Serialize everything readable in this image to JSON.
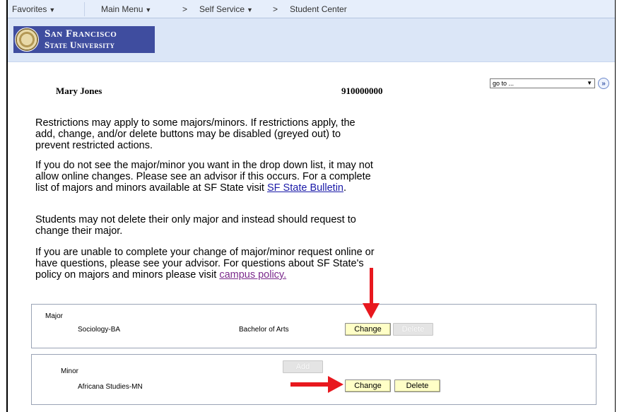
{
  "nav": {
    "favorites": "Favorites",
    "main_menu": "Main Menu",
    "separator": ">",
    "self_service": "Self Service",
    "student_center": "Student Center"
  },
  "logo": {
    "line1": "San Francisco",
    "line2": "State University"
  },
  "student": {
    "name": "Mary Jones",
    "id": "910000000"
  },
  "goto": {
    "selected": "go to ...",
    "button": "»"
  },
  "paragraphs": {
    "p1": "Restrictions may apply to some majors/minors. If restrictions apply, the add, change, and/or delete buttons may be disabled (greyed out) to prevent restricted actions.",
    "p2_text": "If you do not see the major/minor you want in the drop down list, it may not allow online changes. Please see an advisor if this occurs. For a complete list of majors and minors available at SF State visit ",
    "p2_link": "SF State Bulletin",
    "p2_end": ".",
    "p3": "Students may not delete their only major and instead should request to change their major.",
    "p4_text": "If you are unable to complete your change of major/minor request online or have questions, please see your advisor. For questions about SF State's policy on majors and minors please visit ",
    "p4_link": "campus policy."
  },
  "major_box": {
    "label": "Major",
    "program": "Sociology-BA",
    "degree": "Bachelor of Arts",
    "change": "Change",
    "delete": "Delete"
  },
  "minor_box": {
    "label": "Minor",
    "add": "Add",
    "program": "Africana Studies-MN",
    "change": "Change",
    "delete": "Delete"
  },
  "colors": {
    "accent_red": "#e8181e",
    "logo_blue": "#3f4d9f",
    "button_yellow": "#ffffc7"
  }
}
